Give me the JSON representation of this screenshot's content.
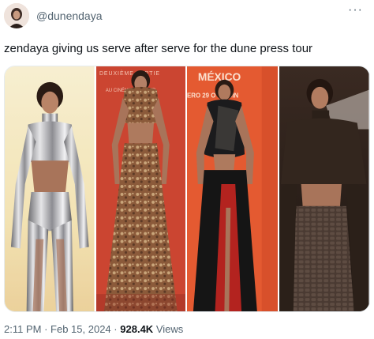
{
  "author": {
    "handle": "@dunendaya"
  },
  "more_menu": {
    "icon": "more-dots-icon",
    "glyph": "···"
  },
  "tweet": {
    "text": "zendaya giving us serve after serve for the dune press tour"
  },
  "media": {
    "count": 4,
    "photos": [
      {
        "description_icon": "photo-metallic-robot-suit"
      },
      {
        "description_icon": "photo-patterned-gown",
        "backdrop_text": "DEUXIÈME PARTIE",
        "backdrop_sub": "AU CINÉMA LE 28 FÉVRIER"
      },
      {
        "description_icon": "photo-black-red-outfit",
        "backdrop_text": "MÉXICO",
        "backdrop_sub": "ERO 29 O EN CIN"
      },
      {
        "description_icon": "photo-brown-turtleneck"
      }
    ]
  },
  "meta": {
    "time": "2:11 PM",
    "separator": "·",
    "date": "Feb 15, 2024",
    "views_count": "928.4K",
    "views_label": "Views"
  },
  "colors": {
    "text_primary": "#0f1419",
    "text_secondary": "#536471",
    "backdrop_red": "#c9412e",
    "backdrop_orange": "#e0532f",
    "backdrop_warm": "#f2e2b8"
  }
}
